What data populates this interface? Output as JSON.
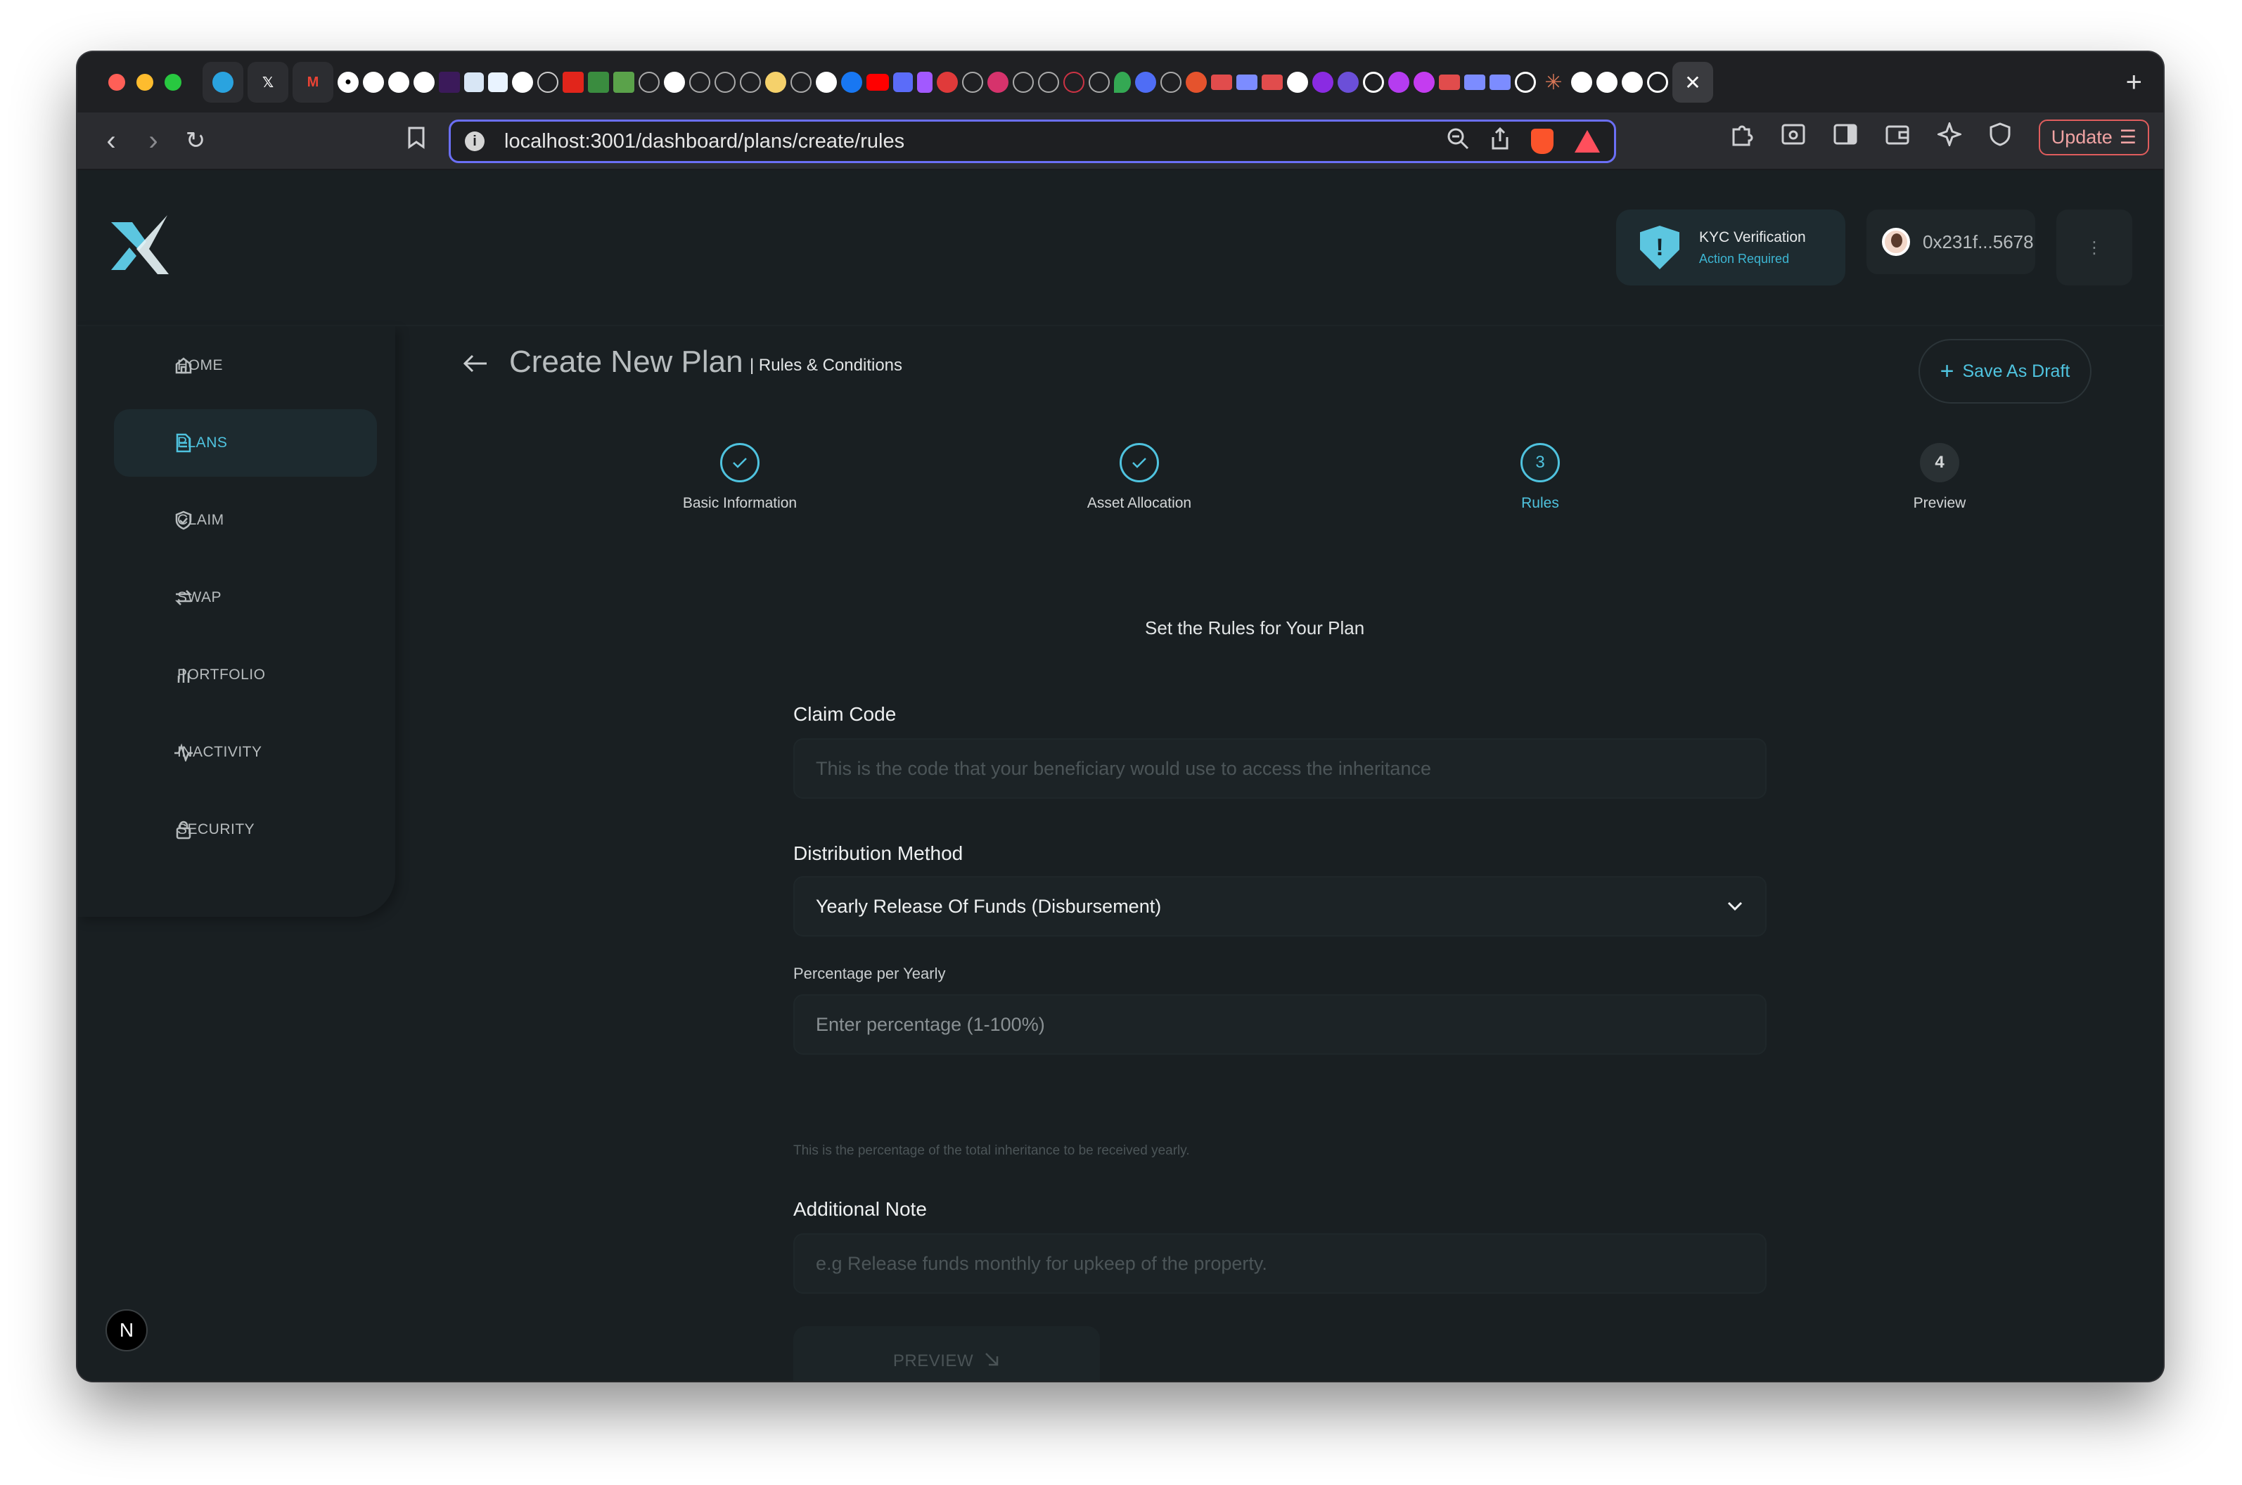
{
  "browser": {
    "url": "localhost:3001/dashboard/plans/create/rules",
    "update_label": "Update",
    "new_tab": "+",
    "close_tab": "✕"
  },
  "header": {
    "kyc_title": "KYC Verification",
    "kyc_status": "Action Required",
    "wallet_address": "0x231f...5678",
    "more": "⋮"
  },
  "sidebar": {
    "items": [
      {
        "label": "HOME",
        "icon": "home-icon"
      },
      {
        "label": "PLANS",
        "icon": "document-icon"
      },
      {
        "label": "CLAIM",
        "icon": "shield-icon"
      },
      {
        "label": "SWAP",
        "icon": "swap-icon"
      },
      {
        "label": "PORTFOLIO",
        "icon": "bar-chart-icon"
      },
      {
        "label": "INACTIVITY",
        "icon": "pulse-icon"
      },
      {
        "label": "SECURITY",
        "icon": "lock-icon"
      }
    ]
  },
  "page": {
    "title": "Create New Plan",
    "subtitle": "| Rules & Conditions",
    "save_draft": "Save As Draft",
    "section_title": "Set the Rules for Your Plan"
  },
  "steps": [
    {
      "label": "Basic Information",
      "state": "done"
    },
    {
      "label": "Asset Allocation",
      "state": "done"
    },
    {
      "label": "Rules",
      "number": "3",
      "state": "current"
    },
    {
      "label": "Preview",
      "number": "4",
      "state": "todo"
    }
  ],
  "form": {
    "claim_code_label": "Claim Code",
    "claim_code_placeholder": "This is the code that your beneficiary would use to access the inheritance",
    "distribution_label": "Distribution Method",
    "distribution_value": "Yearly Release Of Funds (Disbursement)",
    "percentage_label": "Percentage per Yearly",
    "percentage_placeholder": "Enter percentage (1-100%)",
    "percentage_hint": "This is the percentage of the total inheritance to be received yearly.",
    "note_label": "Additional Note",
    "note_placeholder": "e.g Release funds monthly for upkeep of the property.",
    "preview_button": "PREVIEW"
  },
  "dev_badge": "N",
  "colors": {
    "accent": "#4fc3df",
    "background": "#191f22",
    "surface": "#1c2326"
  }
}
